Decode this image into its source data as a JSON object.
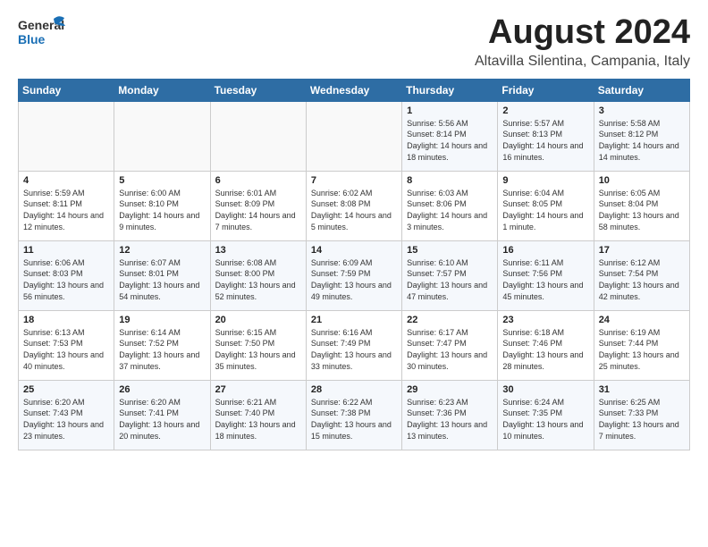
{
  "logo": {
    "general": "General",
    "blue": "Blue",
    "tagline": ""
  },
  "header": {
    "title": "August 2024",
    "subtitle": "Altavilla Silentina, Campania, Italy"
  },
  "days_of_week": [
    "Sunday",
    "Monday",
    "Tuesday",
    "Wednesday",
    "Thursday",
    "Friday",
    "Saturday"
  ],
  "weeks": [
    [
      {
        "day": "",
        "text": ""
      },
      {
        "day": "",
        "text": ""
      },
      {
        "day": "",
        "text": ""
      },
      {
        "day": "",
        "text": ""
      },
      {
        "day": "1",
        "text": "Sunrise: 5:56 AM\nSunset: 8:14 PM\nDaylight: 14 hours and 18 minutes."
      },
      {
        "day": "2",
        "text": "Sunrise: 5:57 AM\nSunset: 8:13 PM\nDaylight: 14 hours and 16 minutes."
      },
      {
        "day": "3",
        "text": "Sunrise: 5:58 AM\nSunset: 8:12 PM\nDaylight: 14 hours and 14 minutes."
      }
    ],
    [
      {
        "day": "4",
        "text": "Sunrise: 5:59 AM\nSunset: 8:11 PM\nDaylight: 14 hours and 12 minutes."
      },
      {
        "day": "5",
        "text": "Sunrise: 6:00 AM\nSunset: 8:10 PM\nDaylight: 14 hours and 9 minutes."
      },
      {
        "day": "6",
        "text": "Sunrise: 6:01 AM\nSunset: 8:09 PM\nDaylight: 14 hours and 7 minutes."
      },
      {
        "day": "7",
        "text": "Sunrise: 6:02 AM\nSunset: 8:08 PM\nDaylight: 14 hours and 5 minutes."
      },
      {
        "day": "8",
        "text": "Sunrise: 6:03 AM\nSunset: 8:06 PM\nDaylight: 14 hours and 3 minutes."
      },
      {
        "day": "9",
        "text": "Sunrise: 6:04 AM\nSunset: 8:05 PM\nDaylight: 14 hours and 1 minute."
      },
      {
        "day": "10",
        "text": "Sunrise: 6:05 AM\nSunset: 8:04 PM\nDaylight: 13 hours and 58 minutes."
      }
    ],
    [
      {
        "day": "11",
        "text": "Sunrise: 6:06 AM\nSunset: 8:03 PM\nDaylight: 13 hours and 56 minutes."
      },
      {
        "day": "12",
        "text": "Sunrise: 6:07 AM\nSunset: 8:01 PM\nDaylight: 13 hours and 54 minutes."
      },
      {
        "day": "13",
        "text": "Sunrise: 6:08 AM\nSunset: 8:00 PM\nDaylight: 13 hours and 52 minutes."
      },
      {
        "day": "14",
        "text": "Sunrise: 6:09 AM\nSunset: 7:59 PM\nDaylight: 13 hours and 49 minutes."
      },
      {
        "day": "15",
        "text": "Sunrise: 6:10 AM\nSunset: 7:57 PM\nDaylight: 13 hours and 47 minutes."
      },
      {
        "day": "16",
        "text": "Sunrise: 6:11 AM\nSunset: 7:56 PM\nDaylight: 13 hours and 45 minutes."
      },
      {
        "day": "17",
        "text": "Sunrise: 6:12 AM\nSunset: 7:54 PM\nDaylight: 13 hours and 42 minutes."
      }
    ],
    [
      {
        "day": "18",
        "text": "Sunrise: 6:13 AM\nSunset: 7:53 PM\nDaylight: 13 hours and 40 minutes."
      },
      {
        "day": "19",
        "text": "Sunrise: 6:14 AM\nSunset: 7:52 PM\nDaylight: 13 hours and 37 minutes."
      },
      {
        "day": "20",
        "text": "Sunrise: 6:15 AM\nSunset: 7:50 PM\nDaylight: 13 hours and 35 minutes."
      },
      {
        "day": "21",
        "text": "Sunrise: 6:16 AM\nSunset: 7:49 PM\nDaylight: 13 hours and 33 minutes."
      },
      {
        "day": "22",
        "text": "Sunrise: 6:17 AM\nSunset: 7:47 PM\nDaylight: 13 hours and 30 minutes."
      },
      {
        "day": "23",
        "text": "Sunrise: 6:18 AM\nSunset: 7:46 PM\nDaylight: 13 hours and 28 minutes."
      },
      {
        "day": "24",
        "text": "Sunrise: 6:19 AM\nSunset: 7:44 PM\nDaylight: 13 hours and 25 minutes."
      }
    ],
    [
      {
        "day": "25",
        "text": "Sunrise: 6:20 AM\nSunset: 7:43 PM\nDaylight: 13 hours and 23 minutes."
      },
      {
        "day": "26",
        "text": "Sunrise: 6:20 AM\nSunset: 7:41 PM\nDaylight: 13 hours and 20 minutes."
      },
      {
        "day": "27",
        "text": "Sunrise: 6:21 AM\nSunset: 7:40 PM\nDaylight: 13 hours and 18 minutes."
      },
      {
        "day": "28",
        "text": "Sunrise: 6:22 AM\nSunset: 7:38 PM\nDaylight: 13 hours and 15 minutes."
      },
      {
        "day": "29",
        "text": "Sunrise: 6:23 AM\nSunset: 7:36 PM\nDaylight: 13 hours and 13 minutes."
      },
      {
        "day": "30",
        "text": "Sunrise: 6:24 AM\nSunset: 7:35 PM\nDaylight: 13 hours and 10 minutes."
      },
      {
        "day": "31",
        "text": "Sunrise: 6:25 AM\nSunset: 7:33 PM\nDaylight: 13 hours and 7 minutes."
      }
    ]
  ]
}
